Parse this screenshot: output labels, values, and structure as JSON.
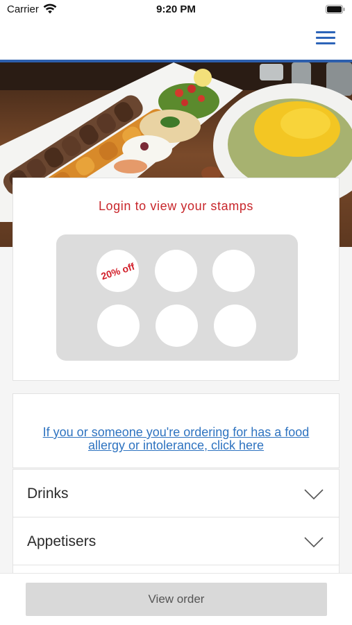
{
  "status_bar": {
    "carrier": "Carrier",
    "time": "9:20 PM"
  },
  "nav": {
    "menu_icon": "hamburger-menu-icon",
    "accent_color": "#2d5fad"
  },
  "hero": {
    "image": "persian-kebab-rice-platter"
  },
  "stamp_card": {
    "title": "Login to view your stamps",
    "title_color": "#c8262b",
    "stamps": [
      {
        "reward": "20% off"
      },
      {
        "reward": ""
      },
      {
        "reward": ""
      },
      {
        "reward": ""
      },
      {
        "reward": ""
      },
      {
        "reward": ""
      }
    ]
  },
  "allergy": {
    "link_text": "If you or someone you're ordering for has a food allergy or intolerance, click here",
    "link_color": "#2e73c0"
  },
  "categories": [
    {
      "label": "Drinks"
    },
    {
      "label": "Appetisers"
    },
    {
      "label": ""
    }
  ],
  "bottom_bar": {
    "view_order_label": "View order"
  }
}
